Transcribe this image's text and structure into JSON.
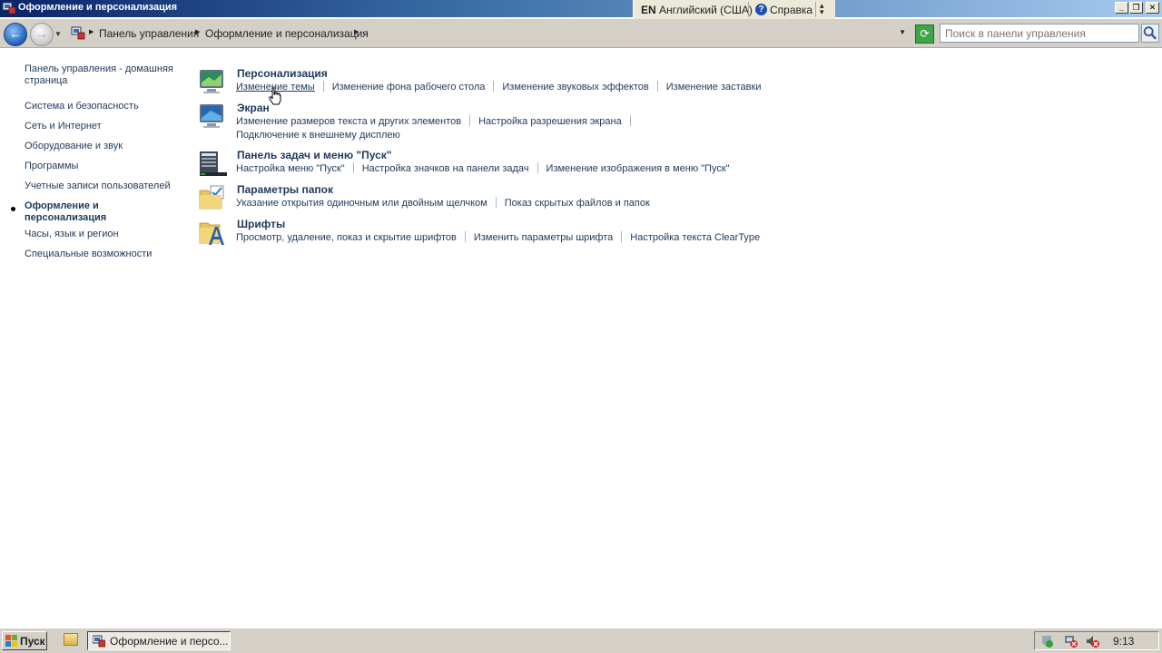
{
  "window": {
    "title": "Оформление и персонализация"
  },
  "langbar": {
    "lang_code": "EN",
    "lang_name": "Английский (США)",
    "help_label": "Справка",
    "help_glyph": "?"
  },
  "window_controls": {
    "minimize": "_",
    "maximize": "❐",
    "close": "✕"
  },
  "address": {
    "back_glyph": "←",
    "forward_glyph": "→",
    "crumbs": [
      "Панель управления",
      "Оформление и персонализация"
    ],
    "search_placeholder": "Поиск в панели управления"
  },
  "sidebar": {
    "items": [
      {
        "label": "Панель управления - домашняя страница"
      },
      {
        "label": "Система и безопасность"
      },
      {
        "label": "Сеть и Интернет"
      },
      {
        "label": "Оборудование и звук"
      },
      {
        "label": "Программы"
      },
      {
        "label": "Учетные записи пользователей"
      },
      {
        "label": "Оформление и персонализация",
        "current": true
      },
      {
        "label": "Часы, язык и регион"
      },
      {
        "label": "Специальные возможности"
      }
    ]
  },
  "categories": [
    {
      "title": "Персонализация",
      "icon": "personalization-icon",
      "lines": [
        [
          "Изменение темы",
          "Изменение фона рабочего стола",
          "Изменение звуковых эффектов",
          "Изменение заставки"
        ]
      ]
    },
    {
      "title": "Экран",
      "icon": "display-icon",
      "lines": [
        [
          "Изменение размеров текста и других элементов",
          "Настройка разрешения экрана"
        ],
        [
          "Подключение к внешнему дисплею"
        ]
      ]
    },
    {
      "title": "Панель задач и меню \"Пуск\"",
      "icon": "taskbar-icon",
      "lines": [
        [
          "Настройка меню \"Пуск\"",
          "Настройка значков на панели задач",
          "Изменение изображения в меню \"Пуск\""
        ]
      ]
    },
    {
      "title": "Параметры папок",
      "icon": "folder-options-icon",
      "lines": [
        [
          "Указание открытия одиночным или двойным щелчком",
          "Показ скрытых файлов и папок"
        ]
      ]
    },
    {
      "title": "Шрифты",
      "icon": "fonts-icon",
      "lines": [
        [
          "Просмотр, удаление, показ и скрытие шрифтов",
          "Изменить параметры шрифта",
          "Настройка текста ClearType"
        ]
      ]
    }
  ],
  "taskbar": {
    "start_label": "Пуск",
    "task_label": "Оформление и персо...",
    "clock": "9:13"
  },
  "colors": {
    "link": "#1e395b",
    "titlebar_start": "#0a246a",
    "titlebar_end": "#a6caf0",
    "chrome": "#d4d0c8"
  }
}
